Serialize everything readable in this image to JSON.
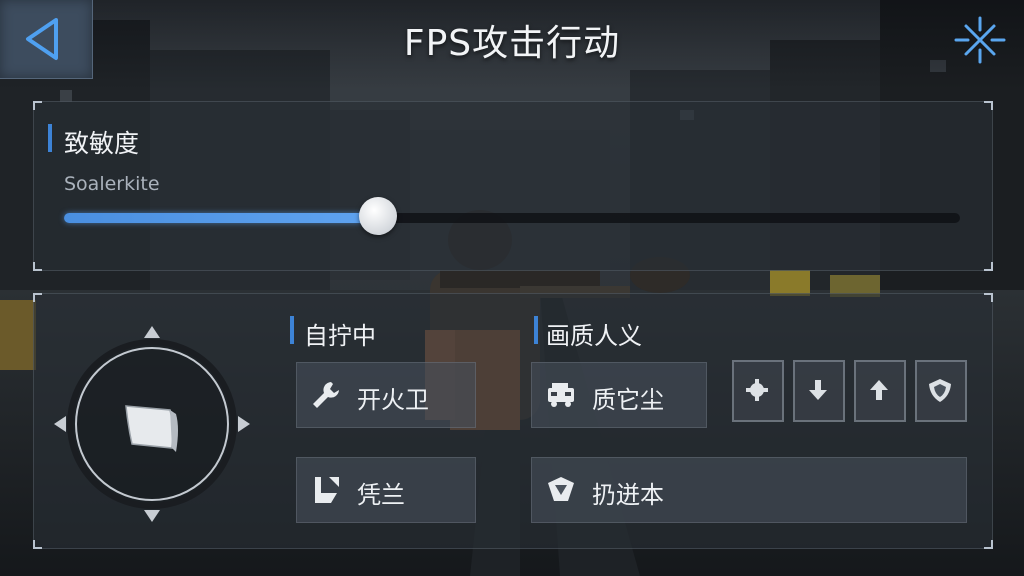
{
  "header": {
    "title": "FPS攻击行动",
    "back_icon": "back-triangle-icon",
    "settings_icon": "crosshair-sparkle-icon"
  },
  "sensitivity": {
    "label": "致敏度",
    "sublabel": "Soalerkite",
    "value": 0.35,
    "accent": "#3d83d6"
  },
  "controls": {
    "group1_label": "自拧中",
    "group2_label": "画质人义",
    "buttons": [
      {
        "label": "开火卫",
        "icon": "wrench-icon"
      },
      {
        "label": "质它尘",
        "icon": "vehicle-icon"
      },
      {
        "label": "凭兰",
        "icon": "corner-boot-icon"
      },
      {
        "label": "扔迸本",
        "icon": "shield-emblem-icon"
      }
    ],
    "small_buttons": [
      {
        "icon": "gear-icon"
      },
      {
        "icon": "arrow-down-icon"
      },
      {
        "icon": "arrow-up-icon"
      },
      {
        "icon": "shield-icon"
      }
    ],
    "joystick_icon": "joystick-pad-icon"
  }
}
